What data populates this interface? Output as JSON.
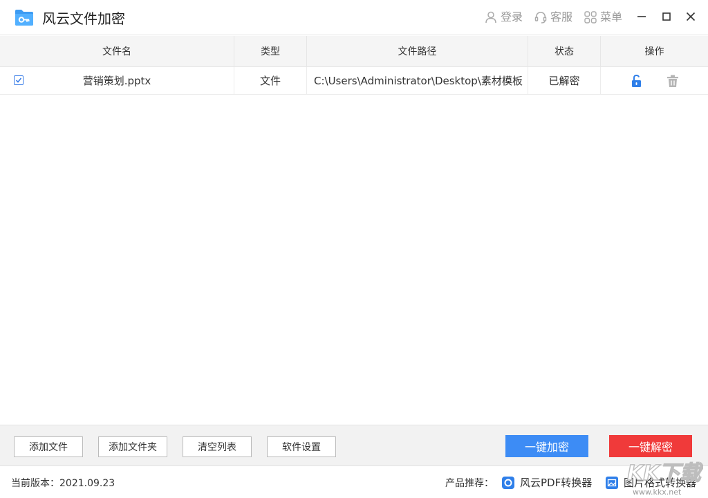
{
  "app": {
    "title": "风云文件加密"
  },
  "header": {
    "login_label": "登录",
    "service_label": "客服",
    "menu_label": "菜单"
  },
  "table": {
    "columns": [
      "文件名",
      "类型",
      "文件路径",
      "状态",
      "操作"
    ],
    "rows": [
      {
        "checked": true,
        "name": "营销策划.pptx",
        "type": "文件",
        "path": "C:\\Users\\Administrator\\Desktop\\素材模板",
        "status": "已解密"
      }
    ]
  },
  "toolbar": {
    "add_file_label": "添加文件",
    "add_folder_label": "添加文件夹",
    "clear_list_label": "清空列表",
    "settings_label": "软件设置",
    "encrypt_all_label": "一键加密",
    "decrypt_all_label": "一键解密"
  },
  "footer": {
    "version_text": "当前版本：2021.09.23",
    "recommend_label": "产品推荐：",
    "product_pdf": "风云PDF转换器",
    "product_image": "图片格式转换器"
  },
  "watermark": {
    "text": "KK下载",
    "url": "www.kkx.net"
  },
  "colors": {
    "accent_blue": "#3a7ee8",
    "encrypt_button": "#3d8cf5",
    "decrypt_button": "#f03a3a",
    "header_bg": "#f5f5f5",
    "toolbar_bg": "#f2f2f2"
  }
}
